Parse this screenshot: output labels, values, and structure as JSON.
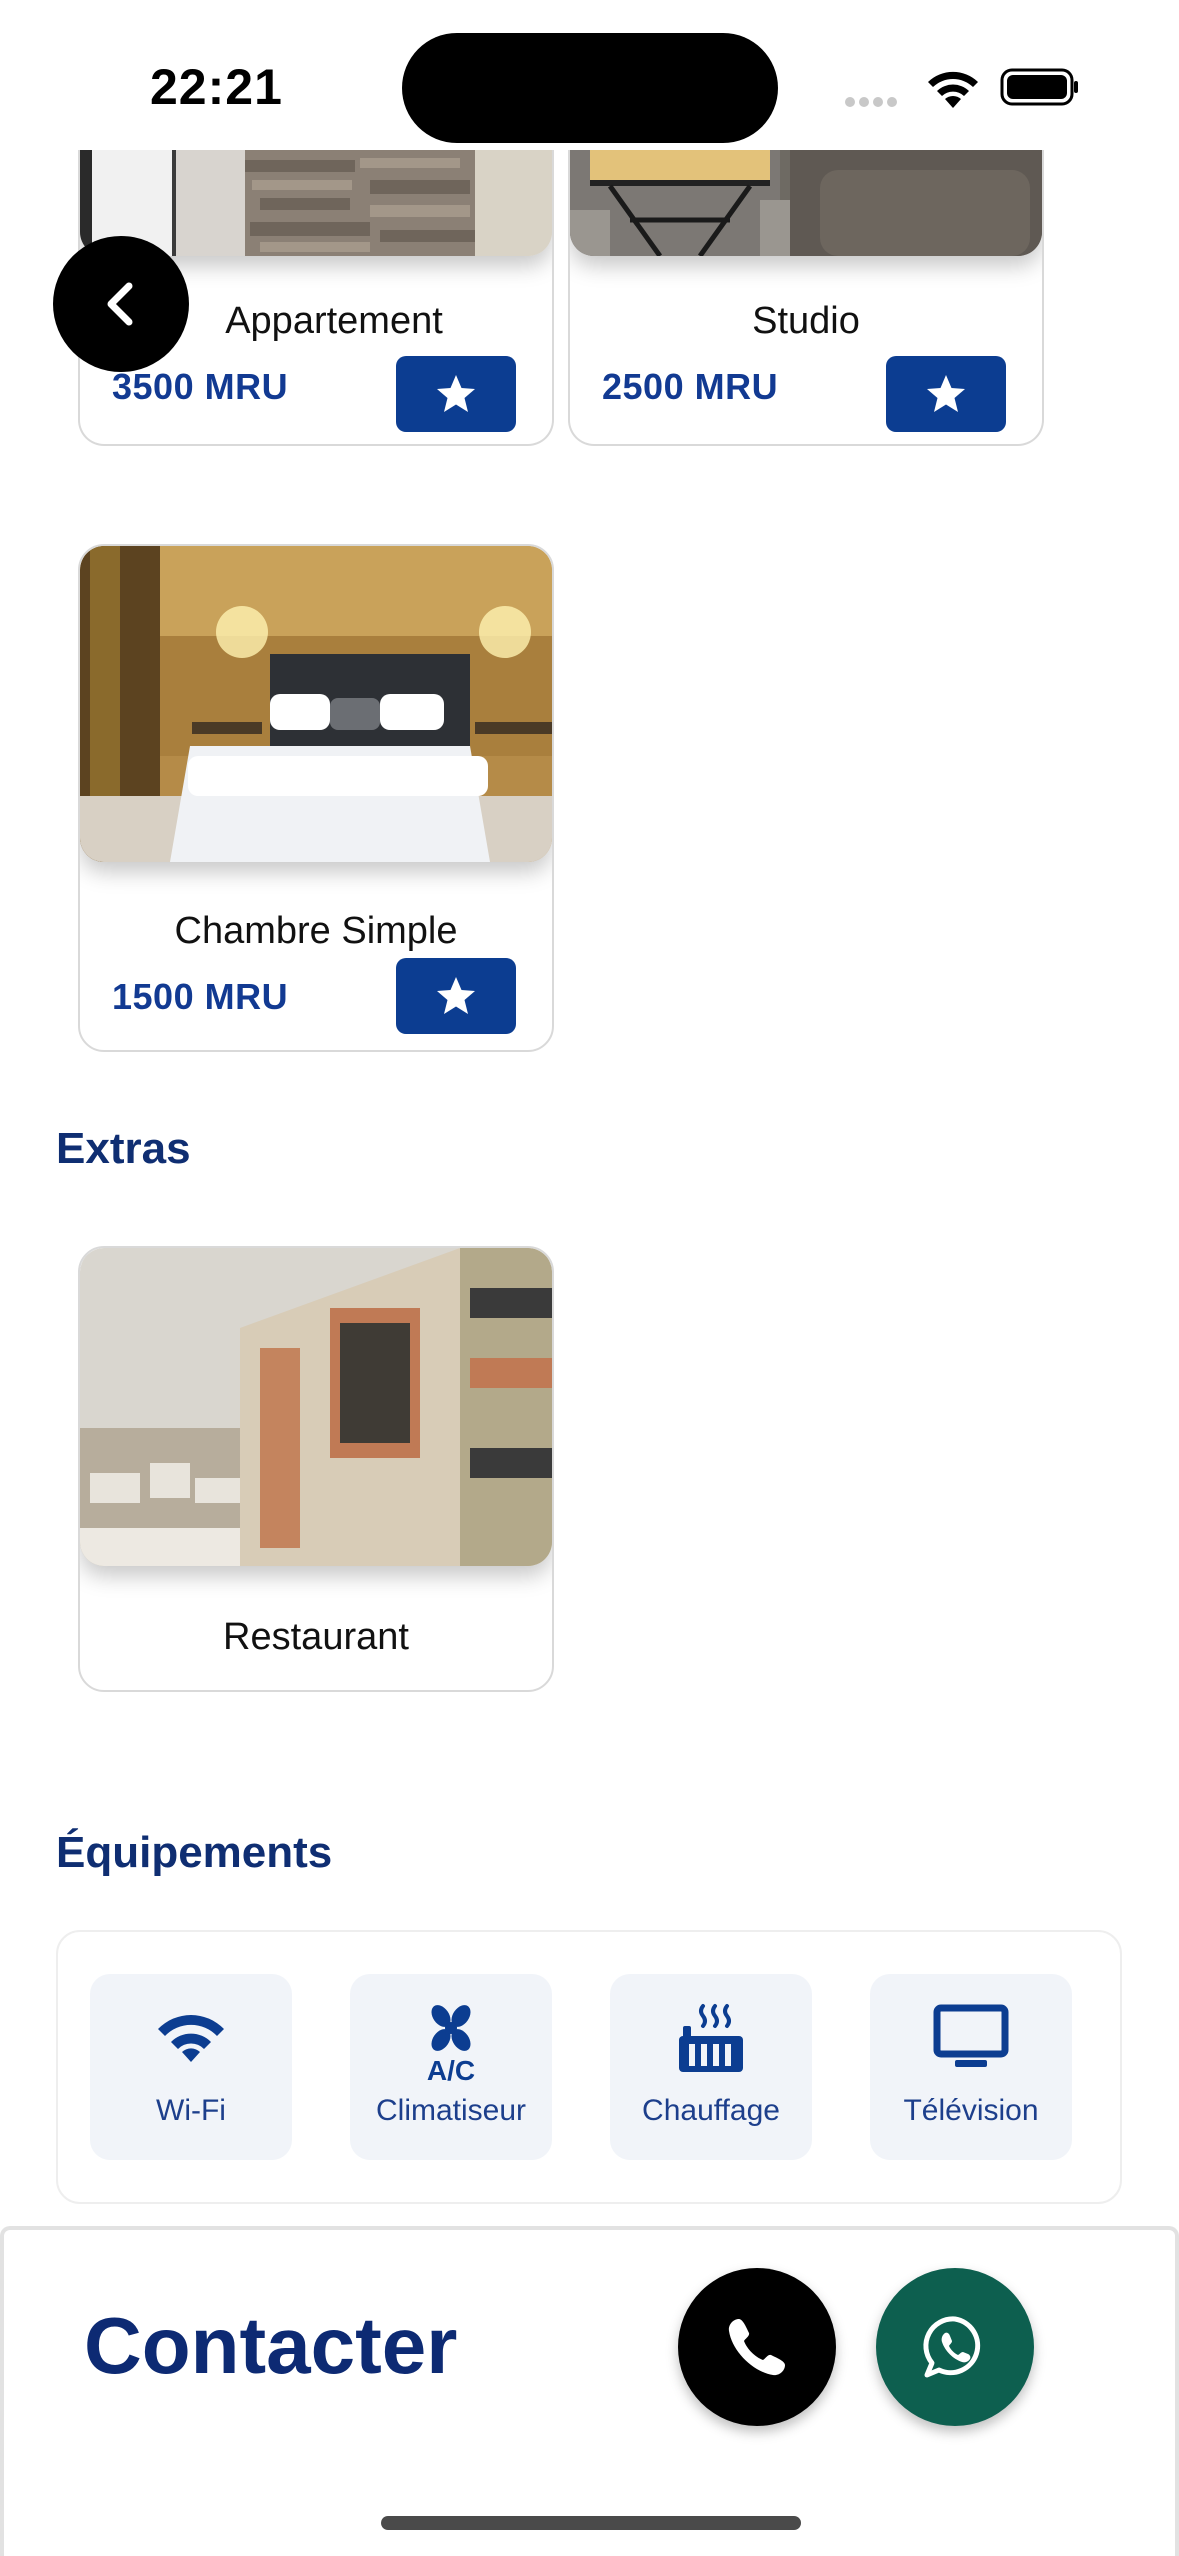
{
  "status_bar": {
    "time": "22:21"
  },
  "rooms": [
    {
      "title": "Appartement",
      "price": "3500 MRU"
    },
    {
      "title": "Studio",
      "price": "2500 MRU"
    },
    {
      "title": "Chambre Simple",
      "price": "1500 MRU"
    }
  ],
  "extras": {
    "heading": "Extras",
    "items": [
      {
        "title": "Restaurant"
      }
    ]
  },
  "equipment": {
    "heading": "Équipements",
    "items": [
      {
        "label": "Wi-Fi",
        "icon": "wifi-icon"
      },
      {
        "label": "Climatiseur",
        "icon": "air-conditioner-icon"
      },
      {
        "label": "Chauffage",
        "icon": "heater-icon"
      },
      {
        "label": "Télévision",
        "icon": "tv-icon"
      }
    ]
  },
  "contact": {
    "label": "Contacter"
  },
  "colors": {
    "primary": "#0c3d91",
    "heading": "#0f2e72",
    "whatsapp": "#0d5f4f"
  }
}
